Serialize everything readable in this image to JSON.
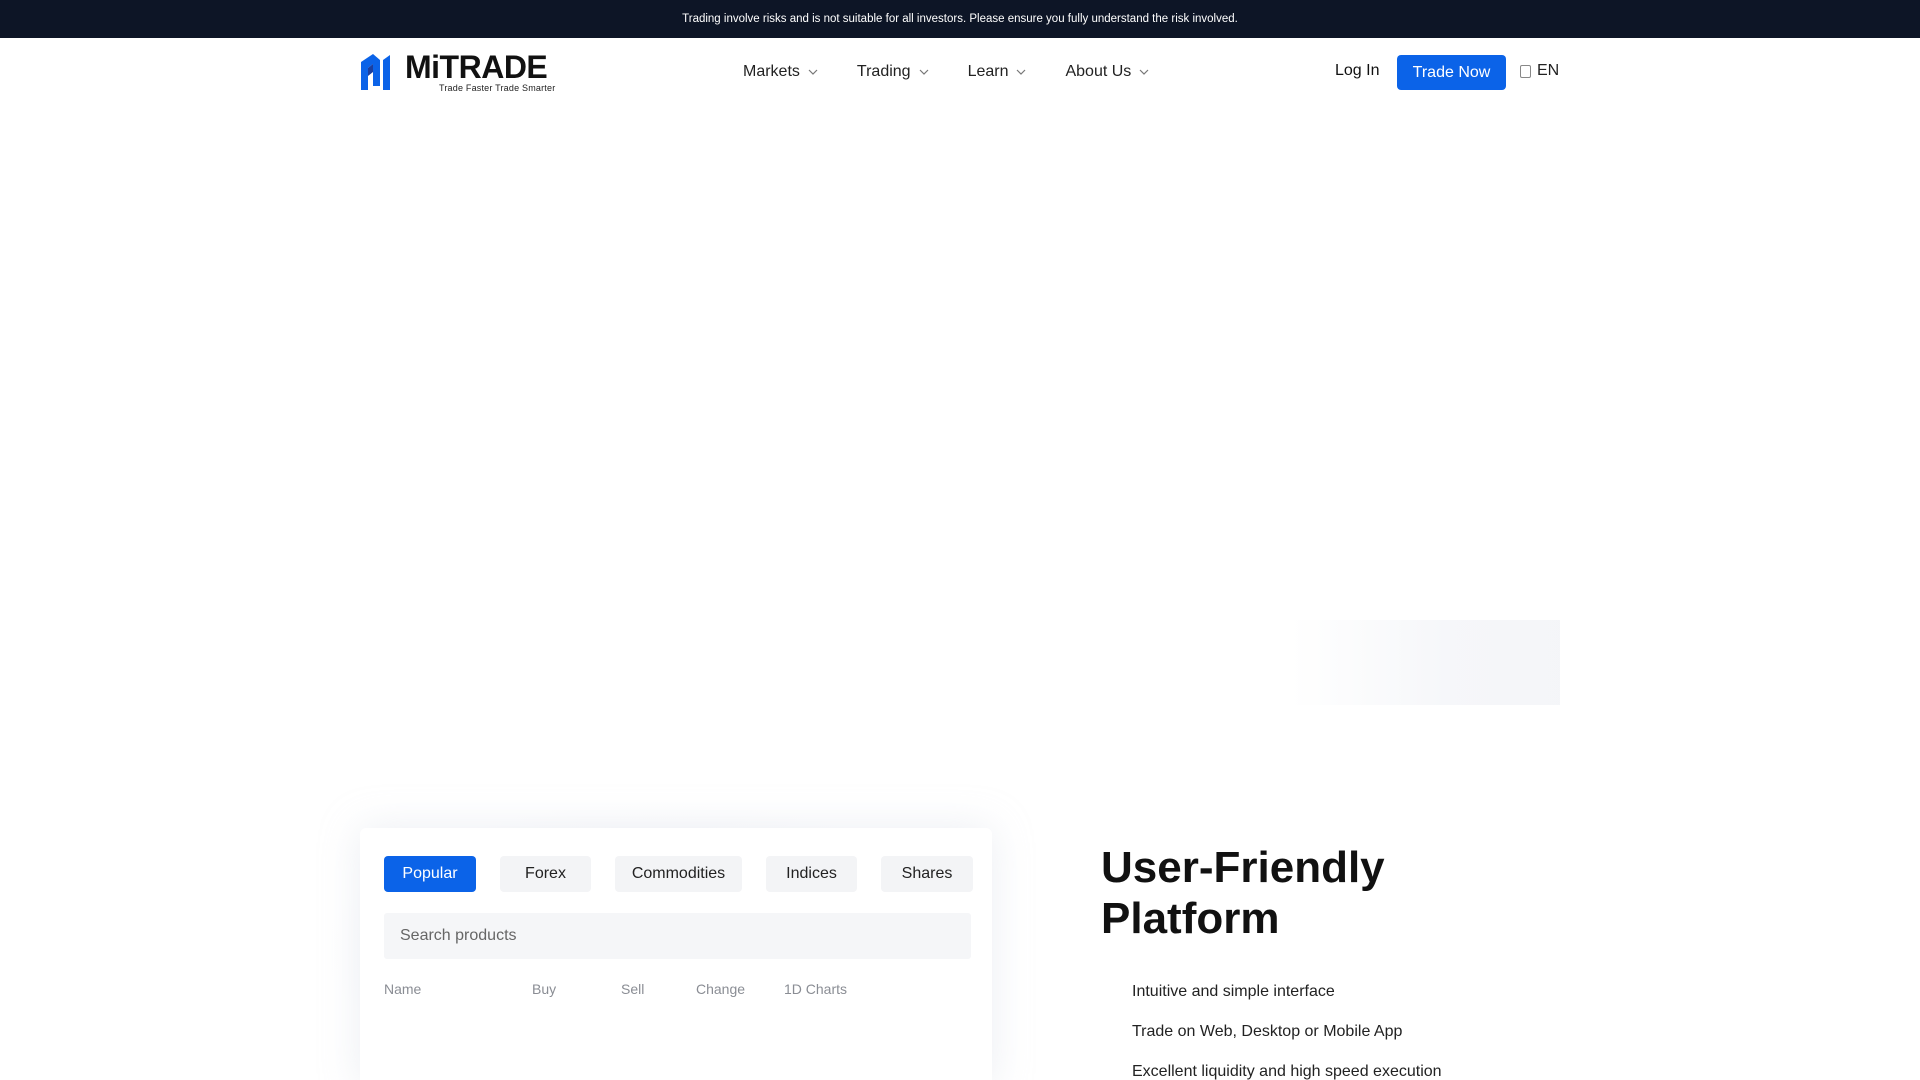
{
  "risk_banner": "Trading involve risks and is not suitable for all investors. Please ensure you fully understand the risk involved.",
  "header": {
    "logo": {
      "word": "MiTRADE",
      "tagline": "Trade Faster Trade Smarter",
      "brand_color": "#0b63e8"
    },
    "nav": [
      {
        "label": "Markets"
      },
      {
        "label": "Trading"
      },
      {
        "label": "Learn"
      },
      {
        "label": "About Us"
      }
    ],
    "login_label": "Log In",
    "trade_now_label": "Trade Now",
    "language": "EN"
  },
  "products": {
    "tabs": [
      {
        "label": "Popular",
        "active": true
      },
      {
        "label": "Forex",
        "active": false
      },
      {
        "label": "Commodities",
        "active": false
      },
      {
        "label": "Indices",
        "active": false
      },
      {
        "label": "Shares",
        "active": false
      }
    ],
    "search_placeholder": "Search products",
    "columns": [
      "Name",
      "Buy",
      "Sell",
      "Change",
      "1D Charts"
    ]
  },
  "feature": {
    "title_line1": "User-Friendly",
    "title_line2": "Platform",
    "points": [
      "Intuitive and simple interface",
      "Trade on Web, Desktop or Mobile App",
      "Excellent liquidity and high speed execution"
    ]
  },
  "colors": {
    "accent": "#0b63e8",
    "banner_bg": "#0d1526"
  }
}
